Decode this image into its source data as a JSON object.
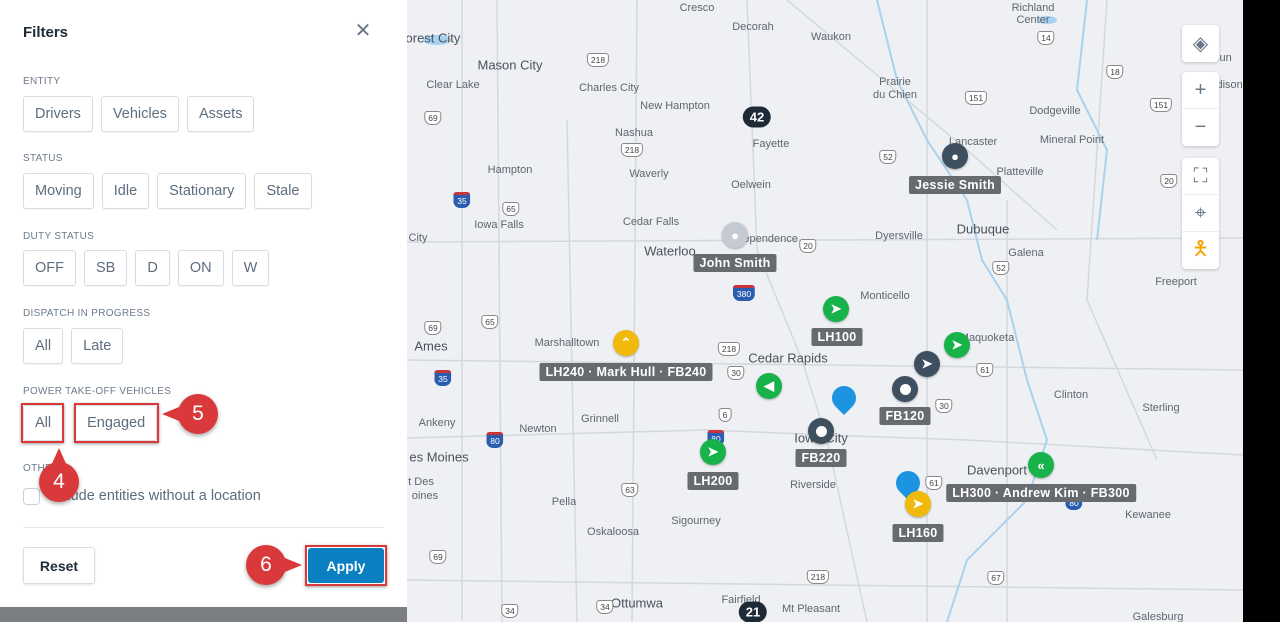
{
  "filters": {
    "title": "Filters",
    "sections": [
      {
        "label": "ENTITY",
        "options": [
          "Drivers",
          "Vehicles",
          "Assets"
        ]
      },
      {
        "label": "STATUS",
        "options": [
          "Moving",
          "Idle",
          "Stationary",
          "Stale"
        ]
      },
      {
        "label": "DUTY STATUS",
        "options": [
          "OFF",
          "SB",
          "D",
          "ON",
          "W"
        ]
      },
      {
        "label": "DISPATCH IN PROGRESS",
        "options": [
          "All",
          "Late"
        ]
      },
      {
        "label": "POWER TAKE-OFF VEHICLES",
        "options": [
          "All",
          "Engaged"
        ]
      },
      {
        "label": "OTHER"
      }
    ],
    "other_checkbox": "Include entities without a location",
    "reset": "Reset",
    "apply": "Apply"
  },
  "callouts": [
    "4",
    "5",
    "6"
  ],
  "map": {
    "towns": [
      "Cresco",
      "Decorah",
      "Waukon",
      "Richland",
      "Center",
      "Forest City",
      "Mason City",
      "Clear Lake",
      "Charles City",
      "New Hampton",
      "Prairie",
      "du Chien",
      "Dodgeville",
      "Nashua",
      "Lancaster",
      "Mineral Point",
      "Fayette",
      "Platteville",
      "Hampton",
      "Waverly",
      "Oelwein",
      "Cedar Falls",
      "Iowa Falls",
      "City",
      "Independence",
      "Waterloo",
      "Dyersville",
      "Dubuque",
      "Galena",
      "Freeport",
      "Monticello",
      "Maquoketa",
      "Marshalltown",
      "Ames",
      "Cedar Rapids",
      "Clinton",
      "Sterling",
      "Ankeny",
      "Grinnell",
      "Newton",
      "Iowa City",
      "es Moines",
      "Davenport",
      "Riverside",
      "Pella",
      "Sigourney",
      "Oskaloosa",
      "Kewanee",
      "Ottumwa",
      "Fairfield",
      "Mt Pleasant",
      "Galesburg",
      "t Des",
      "oines",
      "Madison",
      "Sun"
    ],
    "shields": [
      "218",
      "218",
      "69",
      "35",
      "65",
      "20",
      "380",
      "65",
      "69",
      "35",
      "218",
      "30",
      "6",
      "80",
      "80",
      "63",
      "61",
      "61",
      "30",
      "80",
      "14",
      "18",
      "151",
      "52",
      "151",
      "52",
      "20",
      "69",
      "218",
      "34",
      "34",
      "67"
    ],
    "labels": [
      "Jessie Smith",
      "John Smith",
      "LH100",
      "FB120",
      "FB220",
      "LH200",
      "LH240 · Mark Hull · FB240",
      "LH300 · Andrew Kim · FB300",
      "LH160"
    ],
    "clusters": [
      "42",
      "21"
    ],
    "colors": {
      "moving": "#18b24a",
      "stationary": "#3e4f60",
      "idle": "#f0b90b",
      "asset": "#1c94e0",
      "accent": "#0a7fc2",
      "callout": "#d9393a"
    },
    "controls": [
      "layers-icon",
      "zoom-in-icon",
      "zoom-out-icon",
      "fullscreen-icon",
      "locate-icon",
      "street-view-icon"
    ]
  }
}
